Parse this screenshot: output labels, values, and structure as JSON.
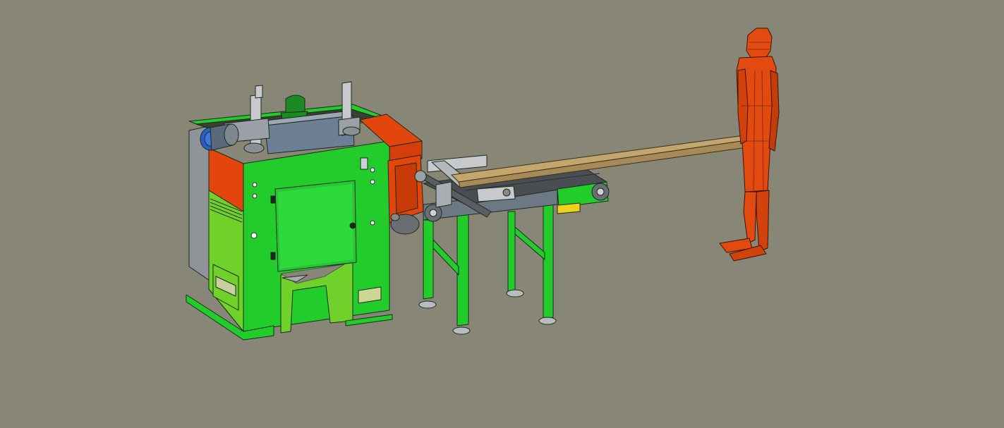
{
  "scene": {
    "kind": "3d-cad-model-view",
    "colors": {
      "background": "#888677",
      "machine_green": "#22cc2b",
      "machine_light_green": "#6fd12a",
      "machine_orange": "#e2460c",
      "steel_gray": "#9a9fa6",
      "board_wood": "#a88a58",
      "belt_dark": "#4a4d52",
      "motor_blue": "#2b5fc8",
      "human_orange": "#e24a10",
      "outline": "#1c2a1c"
    },
    "objects": [
      {
        "name": "saw-machine-body",
        "icon": "machine"
      },
      {
        "name": "control-cabinet-door",
        "icon": "panel"
      },
      {
        "name": "blue-drive-motor",
        "icon": "motor"
      },
      {
        "name": "top-cover",
        "icon": "cover"
      },
      {
        "name": "roller-conveyor",
        "icon": "conveyor"
      },
      {
        "name": "wooden-board",
        "icon": "board"
      },
      {
        "name": "scale-human-figure",
        "icon": "person"
      }
    ]
  }
}
